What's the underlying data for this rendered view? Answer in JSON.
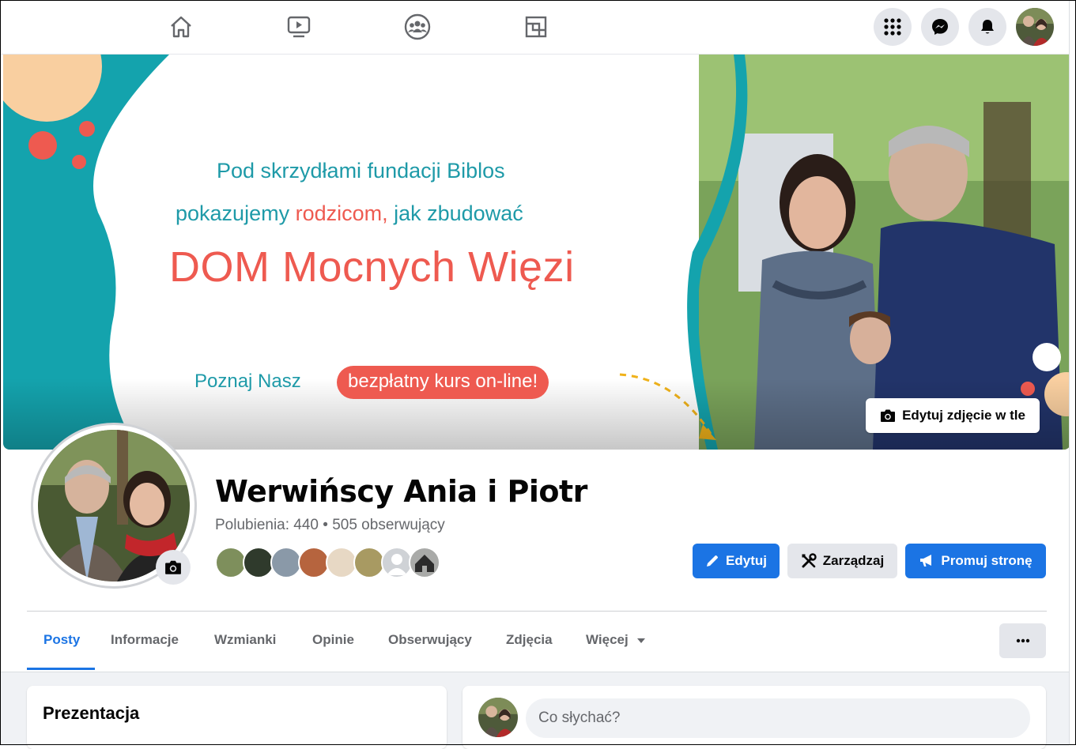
{
  "nav": {
    "icons": [
      "home-icon",
      "video-icon",
      "groups-icon",
      "gaming-icon"
    ],
    "right": [
      "menu-grid-icon",
      "messenger-icon",
      "notifications-icon"
    ]
  },
  "cover": {
    "line1": "Pod skrzydłami fundacji Biblos",
    "line2_a": "pokazujemy ",
    "line2_b": "rodzicom,",
    "line2_c": " jak zbudować",
    "line3": "DOM Mocnych Więzi",
    "line4": "Poznaj Nasz",
    "pill": "bezpłatny kurs on-line!",
    "edit_label": "Edytuj zdjęcie w tle",
    "colors": {
      "teal": "#14a3ad",
      "red": "#ee5a50",
      "peach": "#f9cfa0"
    }
  },
  "profile": {
    "name": "Werwińscy Ania i Piotr",
    "stats": "Polubienia: 440 • 505 obserwujący",
    "friend_count": 8
  },
  "actions": {
    "edit": "Edytuj",
    "manage": "Zarządzaj",
    "promote": "Promuj stronę"
  },
  "tabs": [
    "Posty",
    "Informacje",
    "Wzmianki",
    "Opinie",
    "Obserwujący",
    "Zdjęcia",
    "Więcej"
  ],
  "active_tab": "Posty",
  "left_card": {
    "title": "Prezentacja"
  },
  "composer": {
    "placeholder": "Co słychać?"
  },
  "colors": {
    "accent": "#1b74e4",
    "secondary_text": "#65676b",
    "bg": "#f0f2f5"
  }
}
